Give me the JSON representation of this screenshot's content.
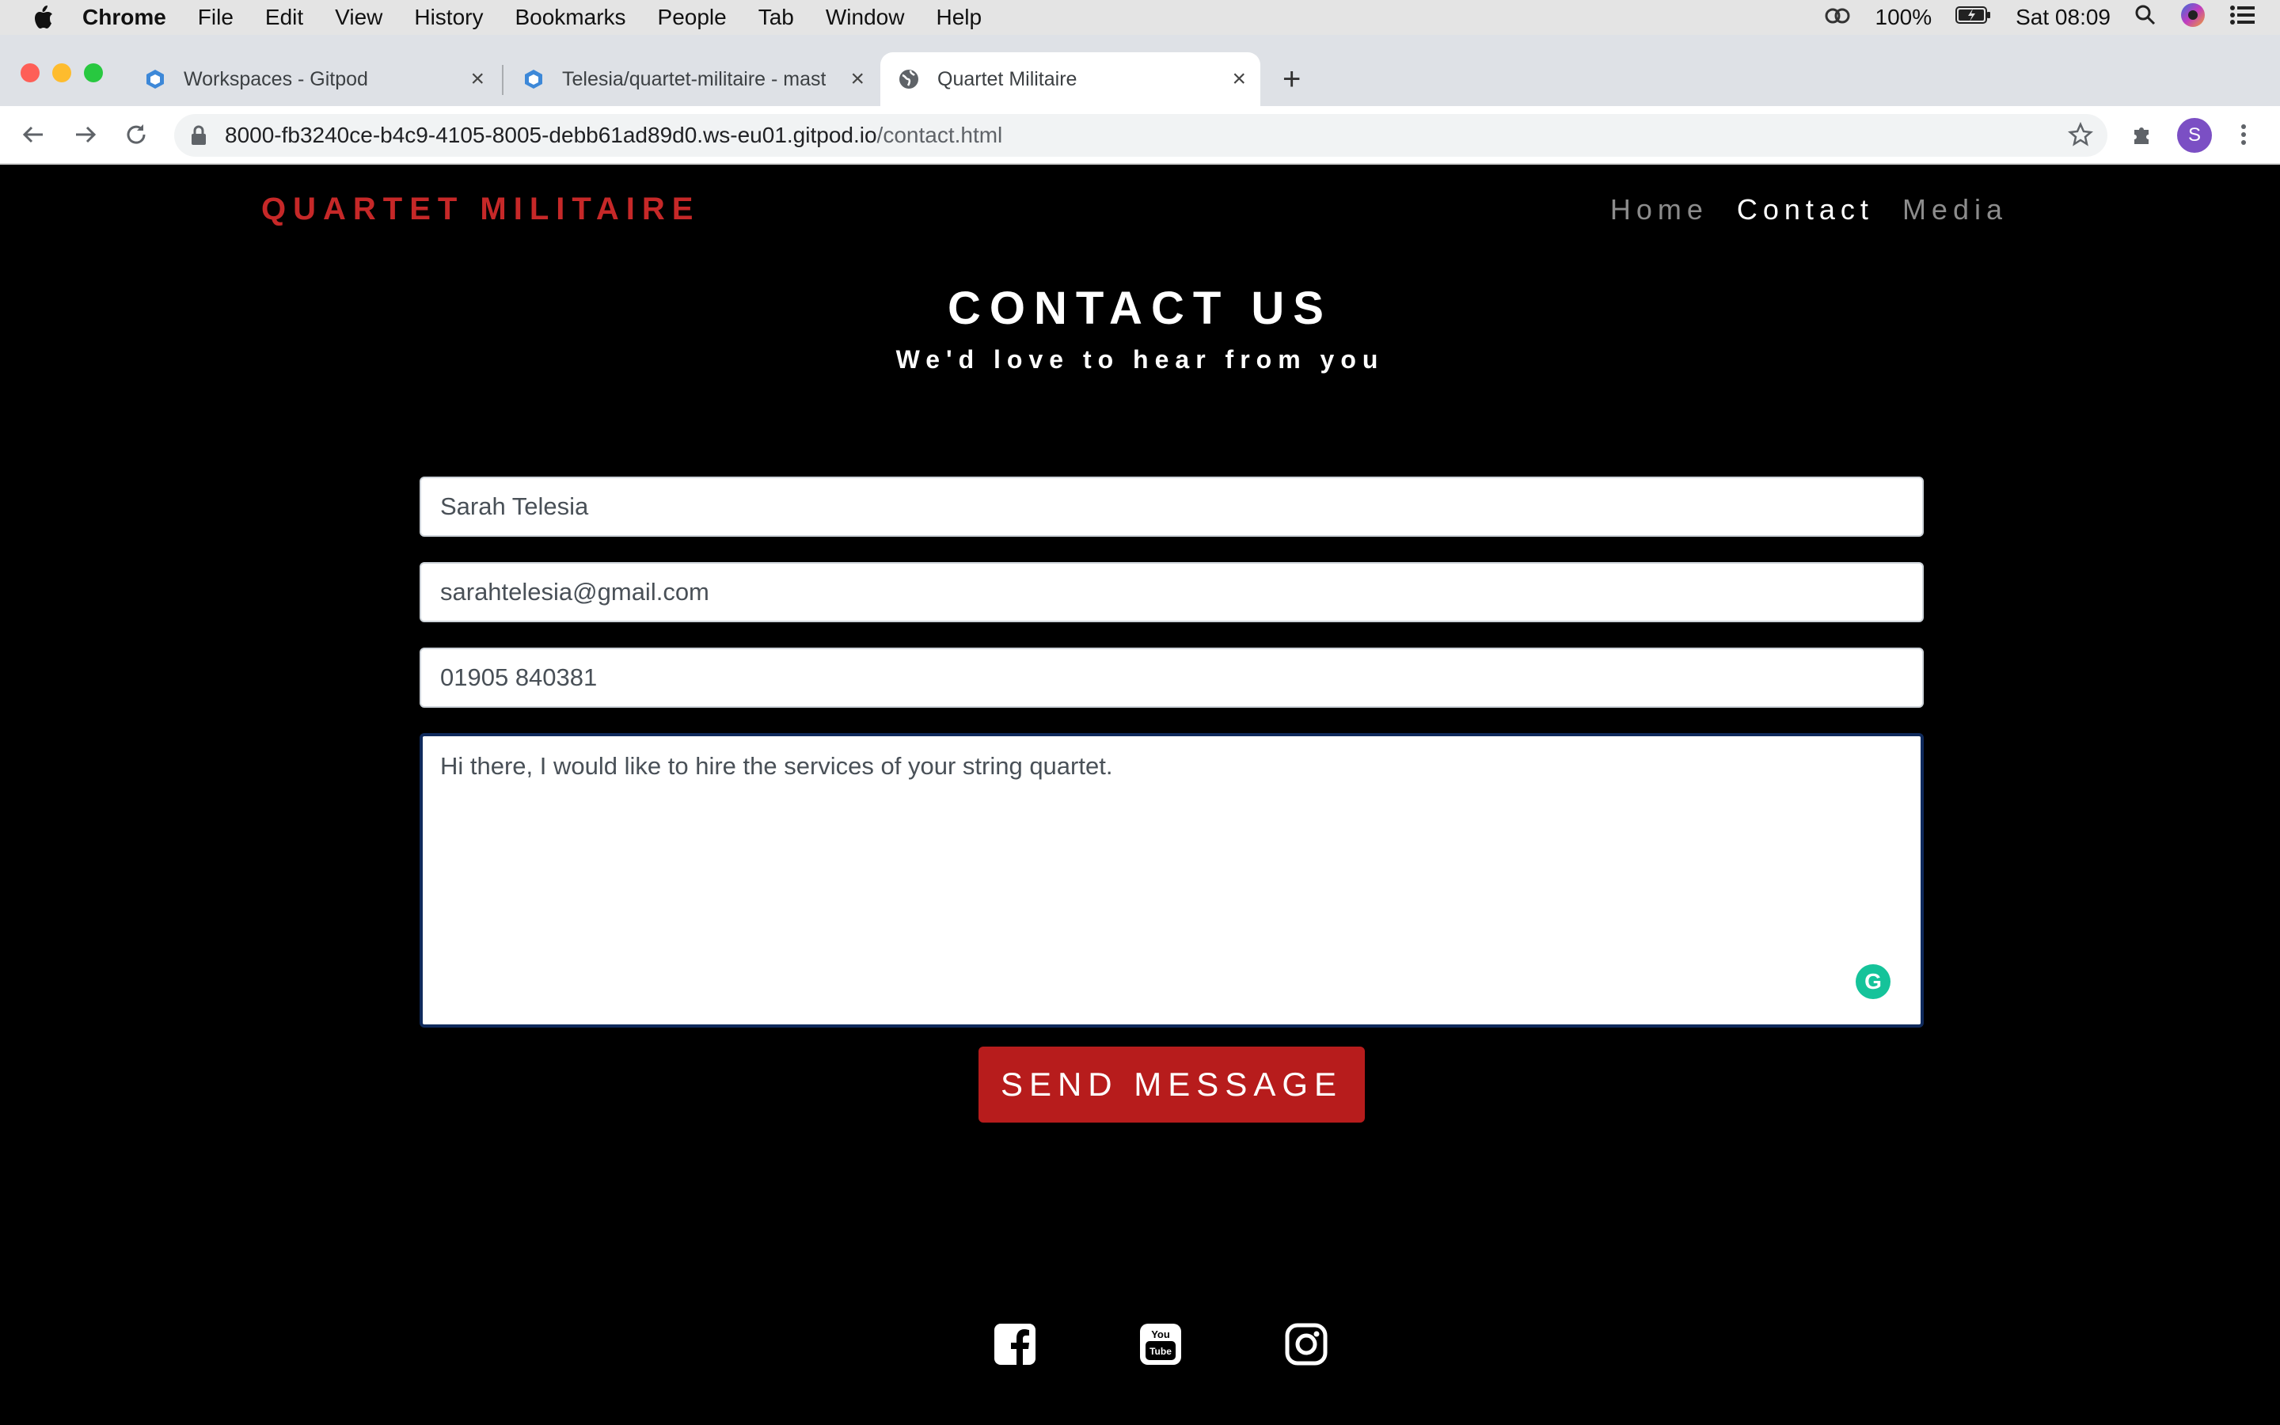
{
  "menubar": {
    "items": [
      "Chrome",
      "File",
      "Edit",
      "View",
      "History",
      "Bookmarks",
      "People",
      "Tab",
      "Window",
      "Help"
    ],
    "battery": "100%",
    "clock": "Sat 08:09"
  },
  "tabs": [
    {
      "title": "Workspaces - Gitpod",
      "icon": "gitpod-icon"
    },
    {
      "title": "Telesia/quartet-militaire - mast",
      "icon": "gitpod-icon"
    },
    {
      "title": "Quartet Militaire",
      "icon": "globe-icon",
      "active": true
    }
  ],
  "address": {
    "host": "8000-fb3240ce-b4c9-4105-8005-debb61ad89d0.ws-eu01.gitpod.io",
    "path": "/contact.html"
  },
  "profile": {
    "initial": "S"
  },
  "site": {
    "brand": "QUARTET MILITAIRE",
    "nav": [
      {
        "label": "Home",
        "active": false
      },
      {
        "label": "Contact",
        "active": true
      },
      {
        "label": "Media",
        "active": false
      }
    ]
  },
  "contact": {
    "title": "CONTACT US",
    "subtitle": "We'd love to hear from you",
    "name_value": "Sarah Telesia",
    "email_value": "sarahtelesia@gmail.com",
    "phone_value": "01905 840381",
    "message_value": "Hi there, I would like to hire the services of your string quartet.",
    "send_label": "SEND MESSAGE"
  },
  "social": [
    "facebook-icon",
    "youtube-icon",
    "instagram-icon"
  ],
  "colors": {
    "brand": "#c62828",
    "button": "#b71c1c",
    "background": "#000000"
  }
}
